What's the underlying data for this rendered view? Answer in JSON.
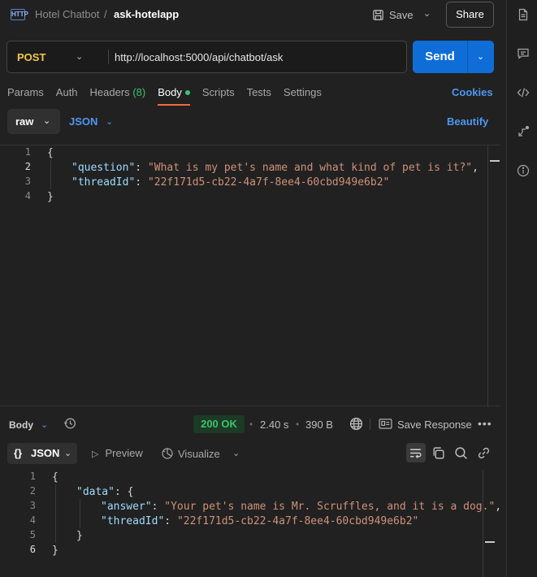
{
  "breadcrumb": {
    "collection": "Hotel Chatbot",
    "separator": "/",
    "request": "ask-hotelapp"
  },
  "header": {
    "save_label": "Save",
    "share_label": "Share",
    "http_badge": "HTTP"
  },
  "request": {
    "method": "POST",
    "url": "http://localhost:5000/api/chatbot/ask",
    "send_label": "Send"
  },
  "tabs": {
    "params": "Params",
    "auth": "Auth",
    "headers": "Headers",
    "headers_count": "(8)",
    "body": "Body",
    "scripts": "Scripts",
    "tests": "Tests",
    "settings": "Settings",
    "cookies": "Cookies",
    "active": "Body"
  },
  "body_options": {
    "mode": "raw",
    "language": "JSON",
    "beautify": "Beautify"
  },
  "request_body": {
    "line_numbers": [
      "1",
      "2",
      "3",
      "4"
    ],
    "open": "{",
    "question_key": "\"question\"",
    "question_value": "\"What is my pet's name and what kind of pet is it?\"",
    "threadId_key": "\"threadId\"",
    "threadId_value": "\"22f171d5-cb22-4a7f-8ee4-60cbd949e6b2\"",
    "close": "}"
  },
  "response_bar": {
    "label": "Body",
    "status": "200 OK",
    "time": "2.40 s",
    "size": "390 B",
    "save_response": "Save Response",
    "more": "•••",
    "separator": "•"
  },
  "response_toolbar": {
    "format": "JSON",
    "format_braces": "{}",
    "preview": "Preview",
    "visualize": "Visualize"
  },
  "response_body": {
    "line_numbers": [
      "1",
      "2",
      "3",
      "4",
      "5",
      "6"
    ],
    "open": "{",
    "data_key": "\"data\"",
    "data_open": "{",
    "answer_key": "\"answer\"",
    "answer_value": "\"Your pet's name is Mr. Scruffles, and it is a dog.\"",
    "threadId_key": "\"threadId\"",
    "threadId_value": "\"22f171d5-cb22-4a7f-8ee4-60cbd949e6b2\"",
    "data_close": "}",
    "close": "}"
  },
  "icons": {
    "rail": [
      "document-icon",
      "comment-icon",
      "code-icon",
      "flow-icon",
      "info-icon"
    ],
    "toolbar": [
      "wrap-icon",
      "copy-icon",
      "search-icon",
      "link-icon"
    ]
  },
  "colors": {
    "accent": "#0e6dd6",
    "method": "#f2c94c",
    "active_tab": "#f26b3a",
    "status_ok": "#3cc36a",
    "link": "#4e97f2",
    "json_key": "#9cdcfe",
    "json_string": "#ce9178"
  }
}
